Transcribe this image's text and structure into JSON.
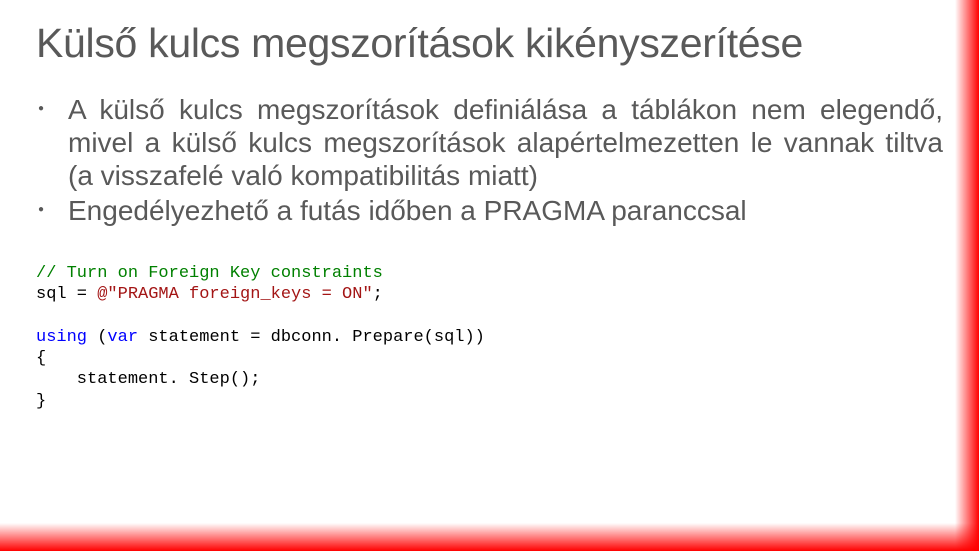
{
  "title": "Külső kulcs megszorítások kikényszerítése",
  "bullets": [
    "A külső kulcs megszorítások definiálása a táblákon nem elegendő, mivel a külső kulcs megszorítások alapértelmezetten le vannak tiltva (a visszafelé való kompatibilitás miatt)",
    "Engedélyezhető a futás időben a PRAGMA paranccsal"
  ],
  "code": {
    "comment": "// Turn on Foreign Key constraints",
    "l2_a": "sql = ",
    "l2_b": "@\"PRAGMA foreign_keys = ON\"",
    "l2_c": ";",
    "l4_a": "using",
    "l4_b": " (",
    "l4_c": "var",
    "l4_d": " statement = dbconn. Prepare(sql))",
    "l5": "{",
    "l6": "    statement. Step();",
    "l7": "}"
  }
}
